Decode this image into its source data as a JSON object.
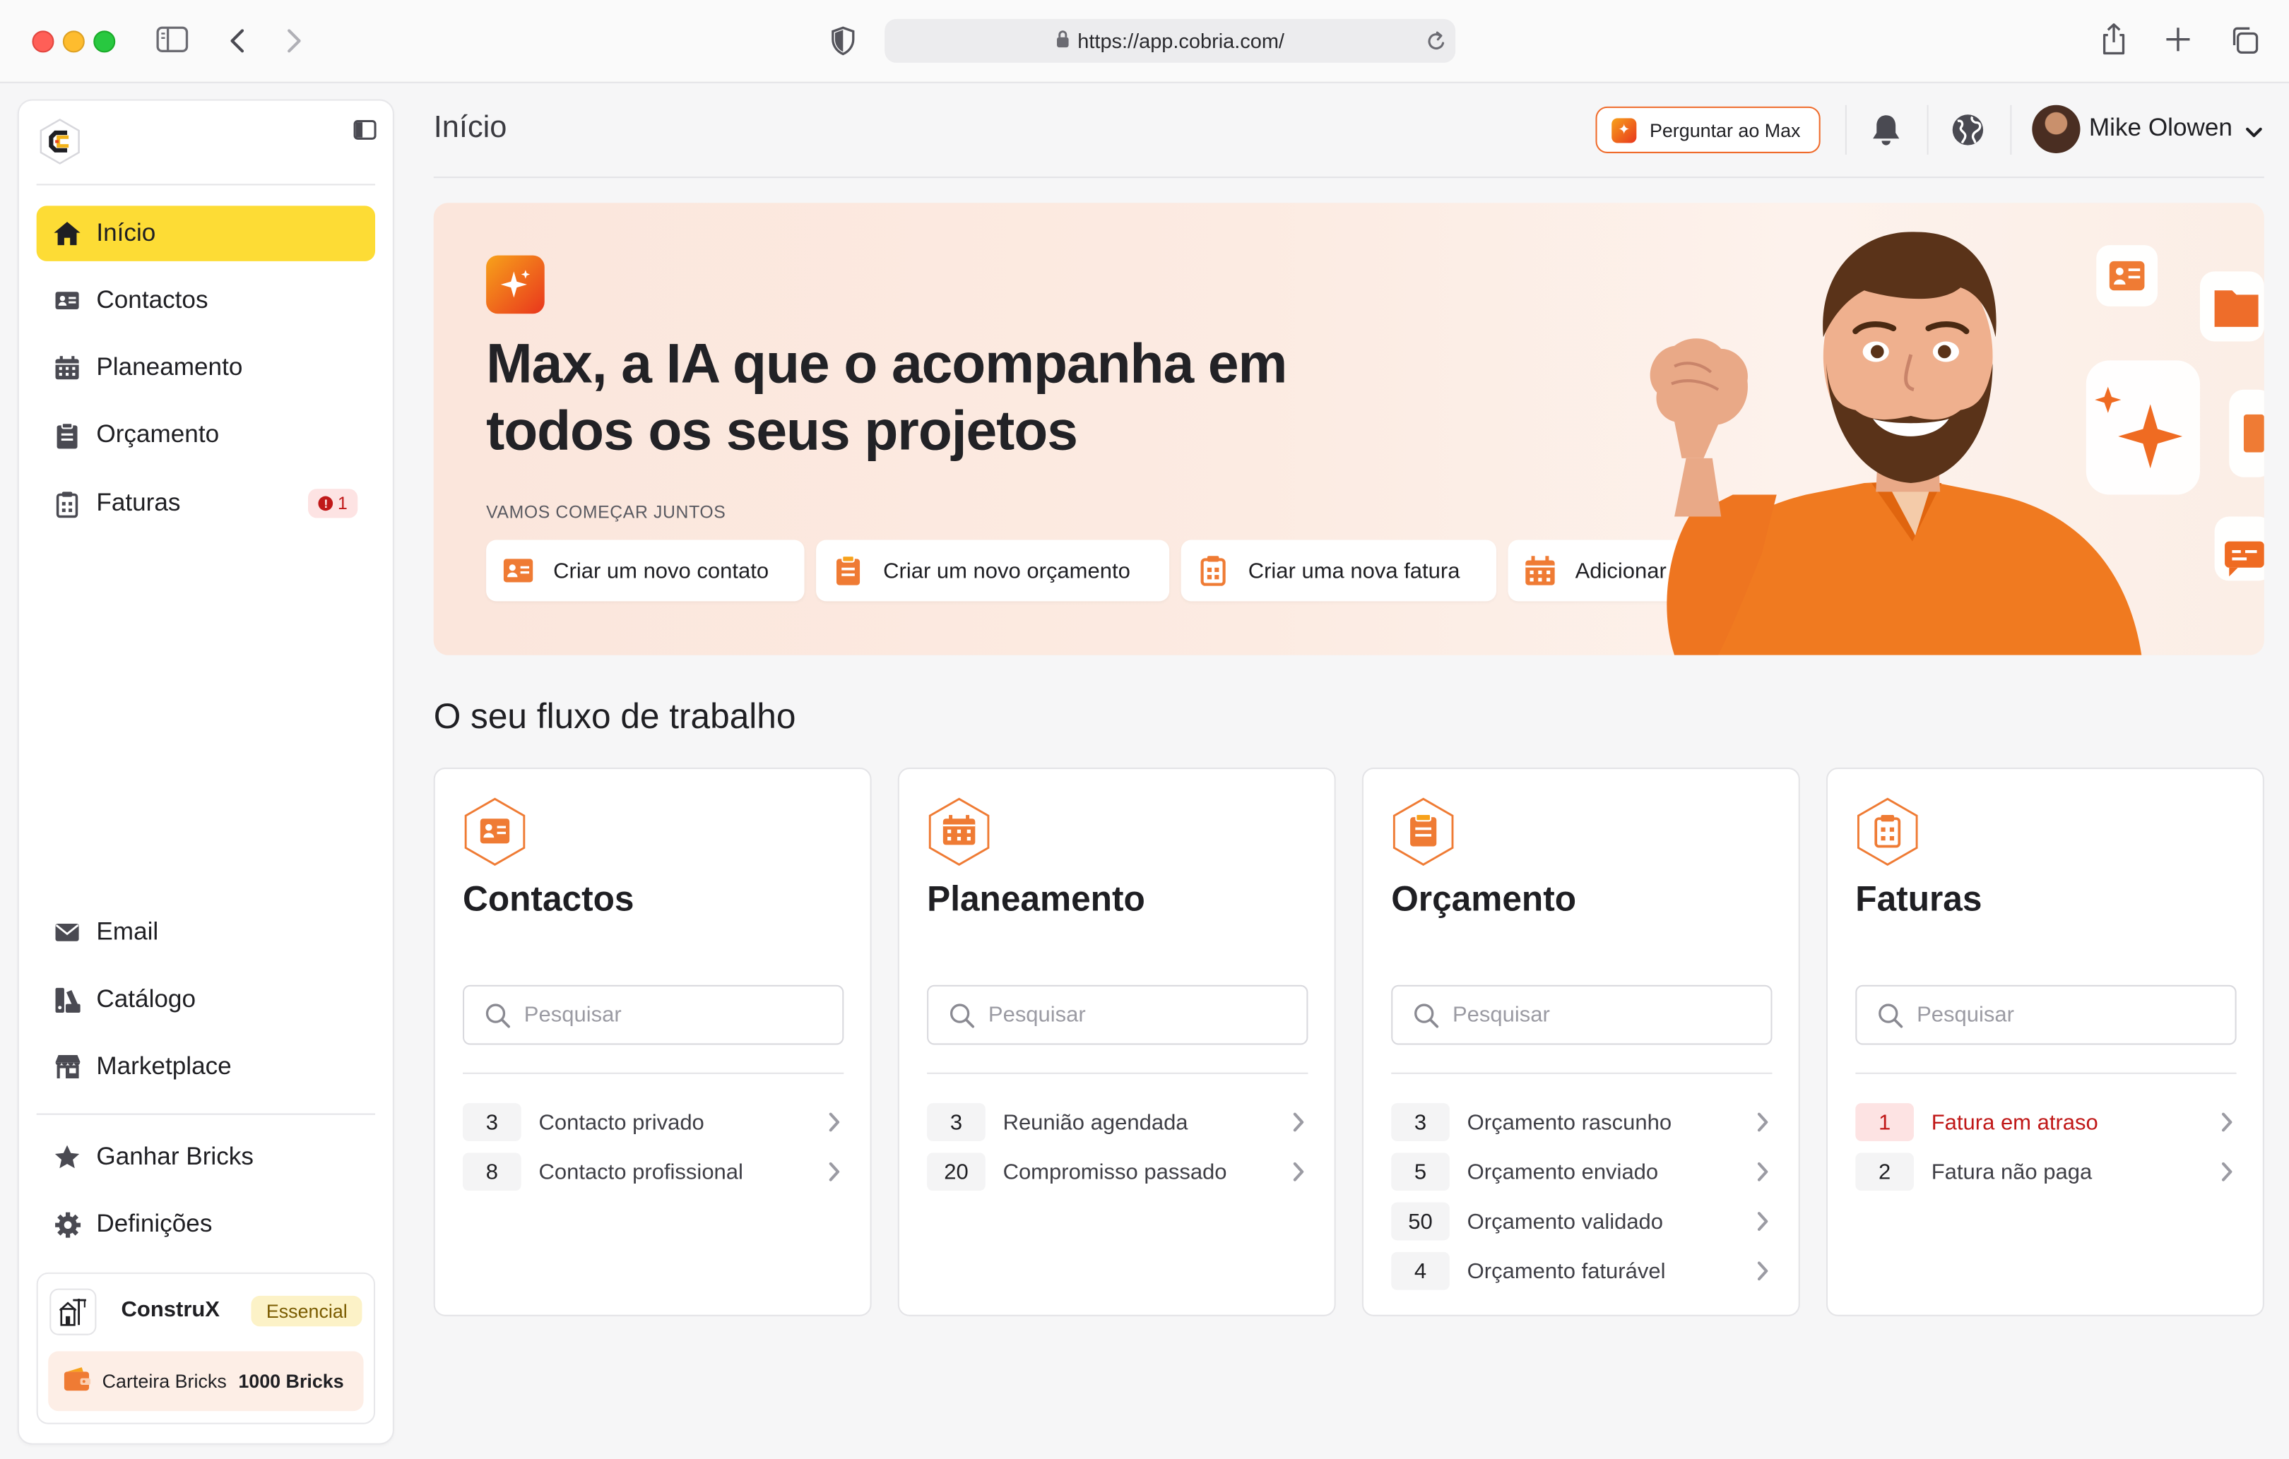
{
  "browser": {
    "url": "https://app.cobria.com/"
  },
  "sidebar": {
    "nav": [
      {
        "label": "Início",
        "icon": "home-icon",
        "active": true
      },
      {
        "label": "Contactos",
        "icon": "contact-card-icon"
      },
      {
        "label": "Planeamento",
        "icon": "calendar-icon"
      },
      {
        "label": "Orçamento",
        "icon": "clipboard-icon"
      },
      {
        "label": "Faturas",
        "icon": "invoice-icon",
        "badge": "1"
      }
    ],
    "bottom_nav": [
      {
        "label": "Email",
        "icon": "mail-icon"
      },
      {
        "label": "Catálogo",
        "icon": "catalog-icon"
      },
      {
        "label": "Marketplace",
        "icon": "store-icon"
      }
    ],
    "extra_nav": [
      {
        "label": "Ganhar Bricks",
        "icon": "star-icon"
      },
      {
        "label": "Definições",
        "icon": "gear-icon"
      }
    ],
    "company": {
      "name": "ConstruX",
      "plan": "Essencial",
      "wallet_label": "Carteira Bricks",
      "wallet_value": "1000 Bricks"
    }
  },
  "header": {
    "title": "Início",
    "ask_max": "Perguntar ao Max",
    "user_name": "Mike Olowen"
  },
  "hero": {
    "title_line1": "Max, a IA que o acompanha em",
    "title_line2": "todos os seus projetos",
    "subtitle": "VAMOS COMEÇAR JUNTOS",
    "actions": [
      "Criar um novo contato",
      "Criar um novo orçamento",
      "Criar uma nova fatura",
      "Adicionar um novo compromisso"
    ]
  },
  "workflow": {
    "title": "O seu fluxo de trabalho",
    "search_placeholder": "Pesquisar",
    "cards": [
      {
        "title": "Contactos",
        "rows": [
          {
            "count": "3",
            "label": "Contacto privado"
          },
          {
            "count": "8",
            "label": "Contacto profissional"
          }
        ]
      },
      {
        "title": "Planeamento",
        "rows": [
          {
            "count": "3",
            "label": "Reunião agendada"
          },
          {
            "count": "20",
            "label": "Compromisso passado"
          }
        ]
      },
      {
        "title": "Orçamento",
        "rows": [
          {
            "count": "3",
            "label": "Orçamento rascunho"
          },
          {
            "count": "5",
            "label": "Orçamento enviado"
          },
          {
            "count": "50",
            "label": "Orçamento validado"
          },
          {
            "count": "4",
            "label": "Orçamento faturável"
          }
        ]
      },
      {
        "title": "Faturas",
        "rows": [
          {
            "count": "1",
            "label": "Fatura em atraso",
            "alert": true
          },
          {
            "count": "2",
            "label": "Fatura não paga"
          }
        ]
      }
    ]
  },
  "colors": {
    "accent_yellow": "#fddc35",
    "accent_orange": "#ef6b2b",
    "alert_red": "#c01818"
  }
}
